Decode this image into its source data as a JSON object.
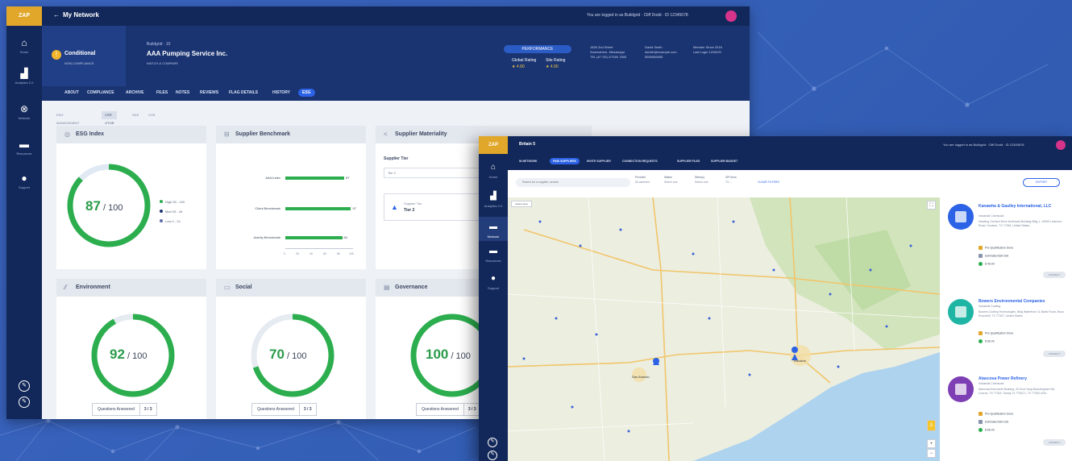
{
  "back_window": {
    "logo": "ZAP",
    "nav_title": "My Network",
    "login_text": "You are logged in as Buildgrid · Cliff Dodd · ID 12345678",
    "sidebar": [
      {
        "icon": "home-icon",
        "label": "Home"
      },
      {
        "icon": "analytics-icon",
        "label": "Analytics 2.0"
      },
      {
        "icon": "network-icon",
        "label": "Network"
      },
      {
        "icon": "resources-icon",
        "label": "Resources"
      },
      {
        "icon": "support-icon",
        "label": "Support"
      }
    ],
    "header": {
      "status": "Conditional",
      "status_sub": "NON-COMPLIANCE",
      "supplier_meta": "Buildgrid · 10",
      "supplier_name": "AAA Pumping Service Inc.",
      "supplier_meta2": "WATCH & COMPARE",
      "performance_label": "PERFORMANCE",
      "global_rating_label": "Global Rating",
      "global_rating_value": "★ 4.90",
      "site_rating_label": "Site Rating",
      "site_rating_value": "★ 4.90",
      "address": "1826 2nd Street\nSomewhere, Mississippi\nTEL (#7 SS) 2/7000 7800",
      "contact": "David Smith\ndsmith@example.com\n5555555555",
      "member_since": "Member Since 2016\nLast Login 12/06/21"
    },
    "tabs": [
      "ABOUT",
      "COMPLIANCE",
      "ARCHIVE",
      "FILES",
      "NOTES",
      "REVIEWS",
      "FLAG DETAILS",
      "HISTORY",
      "ESG"
    ],
    "active_tab": "ESG",
    "subtabs": [
      "ESG MANAGEMENT",
      "CRR OTOR",
      "SDS",
      "CHS"
    ],
    "esg_index": {
      "title": "ESG Index",
      "score": 87,
      "denominator": "/ 100",
      "legend": [
        {
          "label": "High 50 - 100",
          "color": "#2cae4e"
        },
        {
          "label": "Med 25 - 49",
          "color": "#1a3471"
        },
        {
          "label": "Low 0 - 24",
          "color": "#5b6ea8"
        }
      ]
    },
    "benchmark": {
      "title": "Supplier Benchmark",
      "rows": [
        {
          "label": "AAA Index",
          "value": 87
        },
        {
          "label": "Client Benchmark",
          "value": 97
        },
        {
          "label": "Averity Benchmark",
          "value": 84
        }
      ],
      "ticks": [
        "0",
        "20",
        "40",
        "60",
        "80",
        "100"
      ]
    },
    "materiality": {
      "title": "Supplier Materiality",
      "tier_label": "Supplier Tier",
      "tier_input": "Tier 2",
      "card_label": "Supplier Tier",
      "card_value": "Tier 2"
    },
    "environment": {
      "title": "Environment",
      "score": 92,
      "denominator": "/ 100"
    },
    "social": {
      "title": "Social",
      "score": 70,
      "denominator": "/ 100"
    },
    "governance": {
      "title": "Governance",
      "score": 100,
      "denominator": "/ 100"
    },
    "questions_label": "Questions Answered",
    "questions_count": "3 / 3"
  },
  "front_window": {
    "logo": "ZAP",
    "title": "Britain 5",
    "login_text": "You are logged in as Buildgrid · Cliff Dodd · ID 12345678",
    "sidebar": [
      {
        "icon": "home-icon",
        "label": "Home"
      },
      {
        "icon": "analytics-icon",
        "label": "Analytics 2.0"
      },
      {
        "icon": "network-icon",
        "label": "Network"
      },
      {
        "icon": "resources-icon",
        "label": "Resources"
      },
      {
        "icon": "support-icon",
        "label": "Support"
      }
    ],
    "tabs": [
      "IN NETWORK",
      "FIND SUPPLIERS",
      "INVITE SUPPLIER",
      "CONNECTION REQUESTS",
      "SUPPLIER FILES",
      "SUPPLIER BUDGET"
    ],
    "active_tab": "FIND SUPPLIERS",
    "search_placeholder": "Search for a supplier, service",
    "filters": [
      {
        "label": "Provider",
        "value": "All selected"
      },
      {
        "label": "States",
        "value": "Select one"
      },
      {
        "label": "Sites(s)",
        "value": "Select one"
      },
      {
        "label": "ZIP Area",
        "value": "TX, ..."
      }
    ],
    "clear_label": "CLEAR FILTERS",
    "export_label": "EXPORT",
    "map_toggle": "Select area",
    "map_fullscreen": "⛶",
    "map_zoom_in": "+",
    "map_zoom_out": "−",
    "cities": [
      "San Antonio",
      "Houston"
    ],
    "suppliers": [
      {
        "name": "Kanawha & Gaulley International, LLC",
        "category": "Industrial Chemicals",
        "address": "Heading Orchard Drive Northeast Building Bldg 1, 10999 Linsmore Road, Houston, TX 77054, United States",
        "flag1": "Pre-Qualification Done",
        "flag2": "Estimated $1K/Job",
        "rate": "$ 45.00",
        "button": "CONNECT",
        "color": "#2c63e6"
      },
      {
        "name": "Bowers Environmental Companies",
        "category": "Industrial Coating",
        "address": "Bowers Coating Technologies, Bldg Waterfront 11 Baltic Road, Boca Roundhill, TX 77097, United States",
        "flag1": "Pre-Qualification Done",
        "flag2": "",
        "rate": "$ 86.00",
        "button": "CONNECT",
        "color": "#1fb5a5"
      },
      {
        "name": "Atascosa Power Refinery",
        "category": "Industrial Chemicals",
        "address": "Atascosa Brennorth Building, 23 Scot Yang Brandingham Rd, Conroe, TX 77302, Sandy Tx 77302 1, TX 77300 USA",
        "flag1": "Pre-Qualification Done",
        "flag2": "Estimated $1K/Job",
        "rate": "$ 86.00",
        "button": "CONNECT",
        "color": "#7d3fb3"
      }
    ]
  }
}
